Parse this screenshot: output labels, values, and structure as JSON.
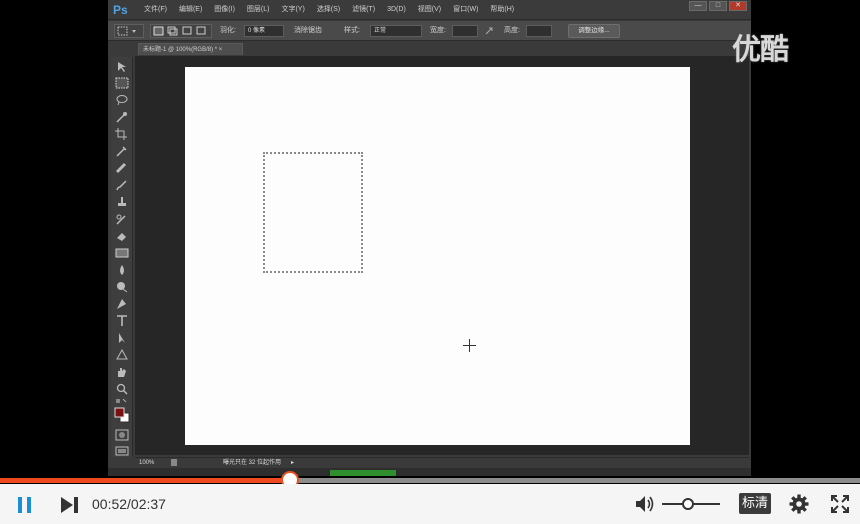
{
  "photoshop": {
    "logo": "Ps",
    "menu": [
      "文件(F)",
      "编辑(E)",
      "图像(I)",
      "图层(L)",
      "文字(Y)",
      "选择(S)",
      "滤镜(T)",
      "3D(D)",
      "视图(V)",
      "窗口(W)",
      "帮助(H)"
    ],
    "window_buttons": [
      "—",
      "□",
      "✕"
    ],
    "options": {
      "feather_label": "羽化:",
      "feather_value": "0 像素",
      "antialias_label": "消除锯齿",
      "style_label": "样式:",
      "style_value": "正常",
      "width_label": "宽度:",
      "height_label": "高度:",
      "refine_edge_label": "调整边缘..."
    },
    "doc_tab": "未标题-1 @ 100%(RGB/8) * ×",
    "status": {
      "zoom": "100%",
      "info": "曝光只在 32 位起作用"
    },
    "foreground_color": "#7a1010",
    "background_color": "#ffffff"
  },
  "watermark": "优酷",
  "player": {
    "progress_fraction": 0.3376,
    "time": "00:52/02:37",
    "volume_fraction": 0.45,
    "quality_label": "标清",
    "accent_color": "#ef4a1f"
  }
}
